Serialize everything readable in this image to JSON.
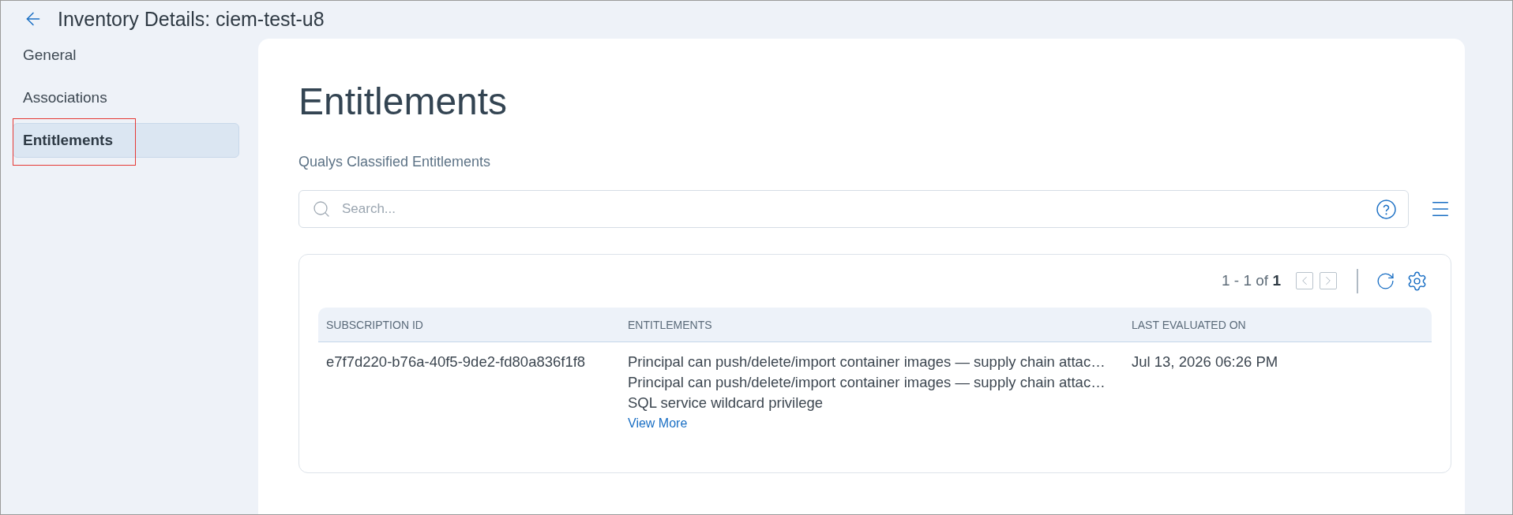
{
  "header": {
    "title": "Inventory Details: ciem-test-u8"
  },
  "sidebar": {
    "items": [
      {
        "label": "General",
        "selected": false,
        "highlighted": false
      },
      {
        "label": "Associations",
        "selected": false,
        "highlighted": false
      },
      {
        "label": "Entitlements",
        "selected": true,
        "highlighted": true
      }
    ]
  },
  "content": {
    "heading": "Entitlements",
    "subtitle": "Qualys Classified Entitlements",
    "search": {
      "placeholder": "Search..."
    },
    "table": {
      "pagination": {
        "summary": "1 - 1 of **1**",
        "prev": {
          "disabled": true
        },
        "next": {
          "disabled": true
        }
      },
      "columns": [
        "SUBSCRIPTION ID",
        "ENTITLEMENTS",
        "LAST EVALUATED ON"
      ],
      "rows": [
        {
          "subscription_id": "e7f7d220-b76a-40f5-9de2-fd80a836f1f8",
          "entitlements": [
            "Principal can push/delete/import container images — supply chain attac…",
            "Principal can push/delete/import container images — supply chain attac…",
            "SQL service wildcard privilege"
          ],
          "view_more": "View More",
          "last_evaluated_on": "Jul 13, 2026 06:26 PM"
        }
      ]
    }
  }
}
